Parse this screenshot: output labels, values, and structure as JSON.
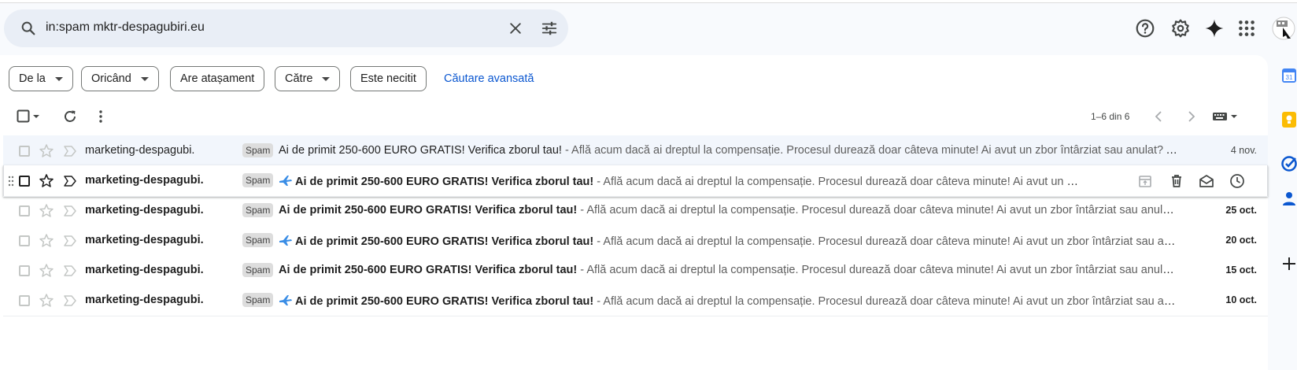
{
  "search": {
    "query": "in:spam mktr-despagubiri.eu"
  },
  "header_icons": [
    "help-icon",
    "settings-icon",
    "gemini-icon",
    "apps-icon",
    "account-avatar"
  ],
  "filters": {
    "chips": [
      "De la",
      "Oricând",
      "Are atașament",
      "Către",
      "Este necitit"
    ],
    "advanced_link": "Căutare avansată"
  },
  "toolbar": {
    "pager": "1–6 din 6"
  },
  "emails": [
    {
      "sender": "marketing-despagubi.",
      "label": "Spam",
      "plane": false,
      "unread": false,
      "subject": "Ai de primit 250-600 EURO GRATIS! Verifica zborul tau!",
      "snippet": " - Află acum dacă ai dreptul la compensație. Procesul durează doar câteva minute! Ai avut un zbor întârziat sau anulat? Află acum dacă ai dreptul la compensație.",
      "date": "4 nov."
    },
    {
      "sender": "marketing-despagubi.",
      "label": "Spam",
      "plane": true,
      "unread": true,
      "subject": "Ai de primit 250-600 EURO GRATIS! Verifica zborul tau!",
      "snippet": " - Află acum dacă ai dreptul la compensație. Procesul durează doar câteva minute! Ai avut un zbor întârziat sau anulat?",
      "date": ""
    },
    {
      "sender": "marketing-despagubi.",
      "label": "Spam",
      "plane": false,
      "unread": true,
      "subject": "Ai de primit 250-600 EURO GRATIS! Verifica zborul tau!",
      "snippet": " - Află acum dacă ai dreptul la compensație. Procesul durează doar câteva minute! Ai avut un zbor întârziat sau anulat? Află acum",
      "date": "25 oct."
    },
    {
      "sender": "marketing-despagubi.",
      "label": "Spam",
      "plane": true,
      "unread": true,
      "subject": "Ai de primit 250-600 EURO GRATIS! Verifica zborul tau!",
      "snippet": " - Află acum dacă ai dreptul la compensație. Procesul durează doar câteva minute! Ai avut un zbor întârziat sau anulat?",
      "date": "20 oct."
    },
    {
      "sender": "marketing-despagubi.",
      "label": "Spam",
      "plane": false,
      "unread": true,
      "subject": "Ai de primit 250-600 EURO GRATIS! Verifica zborul tau!",
      "snippet": " - Află acum dacă ai dreptul la compensație. Procesul durează doar câteva minute! Ai avut un zbor întârziat sau anulat? Află acum",
      "date": "15 oct."
    },
    {
      "sender": "marketing-despagubi.",
      "label": "Spam",
      "plane": true,
      "unread": true,
      "subject": "Ai de primit 250-600 EURO GRATIS! Verifica zborul tau!",
      "snippet": " - Află acum dacă ai dreptul la compensație. Procesul durează doar câteva minute! Ai avut un zbor întârziat sau anulat?",
      "date": "10 oct."
    }
  ],
  "side_apps": [
    "calendar-icon",
    "keep-icon",
    "tasks-icon",
    "contacts-icon",
    "add-icon"
  ]
}
